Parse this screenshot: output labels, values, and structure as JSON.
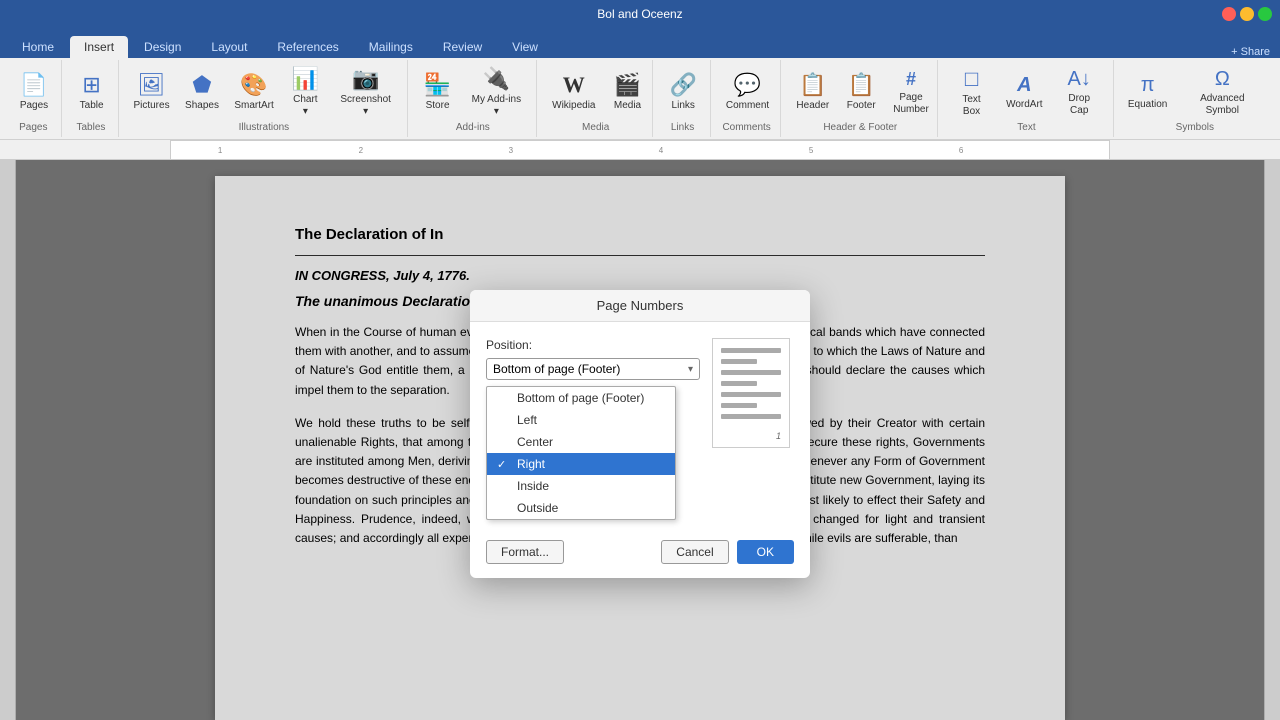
{
  "titleBar": {
    "title": "Bol and Oceenz",
    "shareLabel": "+ Share"
  },
  "tabs": [
    {
      "label": "Home",
      "active": false
    },
    {
      "label": "Insert",
      "active": true
    },
    {
      "label": "Design",
      "active": false
    },
    {
      "label": "Layout",
      "active": false
    },
    {
      "label": "References",
      "active": false
    },
    {
      "label": "Mailings",
      "active": false
    },
    {
      "label": "Review",
      "active": false
    },
    {
      "label": "View",
      "active": false
    }
  ],
  "ribbon": {
    "groups": [
      {
        "name": "pages",
        "label": "Pages",
        "items": [
          {
            "icon": "📄",
            "label": "Pages"
          }
        ]
      },
      {
        "name": "tables",
        "label": "Tables",
        "items": [
          {
            "icon": "⊞",
            "label": "Table"
          }
        ]
      },
      {
        "name": "illustrations",
        "label": "Illustrations",
        "items": [
          {
            "icon": "🖼",
            "label": "Pictures"
          },
          {
            "icon": "⬟",
            "label": "Shapes"
          },
          {
            "icon": "🎨",
            "label": "SmartArt"
          },
          {
            "icon": "📊",
            "label": "Chart ="
          },
          {
            "icon": "📷",
            "label": "Screenshot"
          }
        ]
      },
      {
        "name": "addins",
        "label": "Add-ins",
        "items": [
          {
            "icon": "🏪",
            "label": "Store"
          },
          {
            "icon": "🔌",
            "label": "My Add-ins"
          }
        ]
      },
      {
        "name": "media",
        "label": "Media",
        "items": [
          {
            "icon": "W",
            "label": "Wikipedia"
          },
          {
            "icon": "🎬",
            "label": "Media"
          }
        ]
      },
      {
        "name": "links",
        "label": "Links",
        "items": [
          {
            "icon": "🔗",
            "label": "Links"
          }
        ]
      },
      {
        "name": "comments",
        "label": "Comments",
        "items": [
          {
            "icon": "💬",
            "label": "Comment"
          }
        ]
      },
      {
        "name": "header-footer",
        "label": "Header & Footer",
        "items": [
          {
            "icon": "📋",
            "label": "Header"
          },
          {
            "icon": "📋",
            "label": "Footer"
          },
          {
            "icon": "#",
            "label": "Page\nNumber"
          }
        ]
      },
      {
        "name": "text",
        "label": "Text",
        "items": [
          {
            "icon": "□",
            "label": "Text Box"
          },
          {
            "icon": "A",
            "label": "WordArt"
          },
          {
            "icon": "A↓",
            "label": "Drop Cap"
          }
        ]
      },
      {
        "name": "symbols",
        "label": "Symbols",
        "items": [
          {
            "icon": "Ω",
            "label": "Equation"
          },
          {
            "icon": "Ω",
            "label": "Symbol"
          }
        ]
      }
    ]
  },
  "dialog": {
    "title": "Page Numbers",
    "positionLabel": "Position:",
    "positionValue": "Bottom of page (Footer)",
    "dropdown": {
      "items": [
        {
          "label": "Bottom of page (Footer)",
          "checked": false
        },
        {
          "label": "Left",
          "checked": false
        },
        {
          "label": "Center",
          "checked": false
        },
        {
          "label": "Right",
          "checked": true,
          "highlighted": true
        },
        {
          "label": "Inside",
          "checked": false
        },
        {
          "label": "Outside",
          "checked": false
        }
      ]
    },
    "formatLabel": "Format...",
    "cancelLabel": "Cancel",
    "okLabel": "OK"
  },
  "document": {
    "lines": [
      {
        "type": "bold-partial",
        "text": "The Declaration of In"
      }
    ],
    "heading1": "IN CONGRESS, July 4, 1776.",
    "heading2": "The unanimous Declaration of the thirteen united States of America,",
    "para1": "When in the Course of human events, it becomes necessary for one people to dissolve the political bands which have connected them with another, and to assume among the powers of the earth, the separate and equal station to which the Laws of Nature and of Nature's God entitle them, a decent respect to the opinions of mankind requires that they should declare the causes which impel them to the separation.",
    "para2": "We hold these truths to be self-evident, that all men are created equal, that they are endowed by their Creator with certain unalienable Rights, that among these are Life, Liberty and the pursuit of Happiness.--That to secure these rights, Governments are instituted among Men, deriving their just powers from the consent of the governed, --That whenever any Form of Government becomes destructive of these ends, it is the Right of the People to alter or to abolish it, and to institute new Government, laying its foundation on such principles and organizing its powers in such form, as to them shall seem most likely to effect their Safety and Happiness. Prudence, indeed, will dictate that Governments long established should not be changed for light and transient causes; and accordingly all experience hath shewn, that mankind are more disposed to suffer, while evils are sufferable, than"
  }
}
